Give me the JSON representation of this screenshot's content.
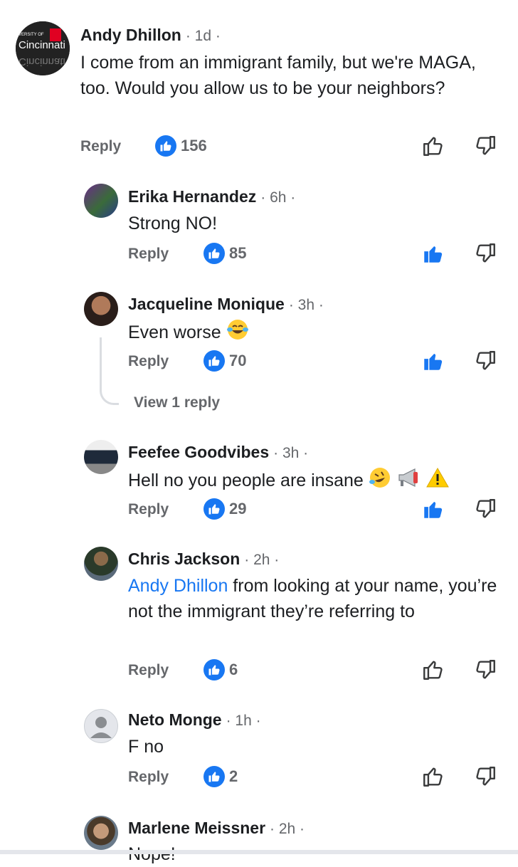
{
  "comments": [
    {
      "name": "Andy Dhillon",
      "meta": "· 1d ·",
      "text": "I come from an immigrant family, but we're MAGA, too. Would you allow us to be your neighbors?",
      "reply": "Reply",
      "likes": "156",
      "logo_text": "Cincinnati",
      "logo_small": "VERSITY OF"
    },
    {
      "name": "Erika Hernandez",
      "meta": "· 6h ·",
      "text": "Strong NO!",
      "reply": "Reply",
      "likes": "85"
    },
    {
      "name": "Jacqueline Monique",
      "meta": "· 3h ·",
      "text": "Even worse",
      "reply": "Reply",
      "likes": "70",
      "view_replies": "View 1 reply"
    },
    {
      "name": "Feefee Goodvibes",
      "meta": "· 3h ·",
      "text": "Hell no you people are insane",
      "reply": "Reply",
      "likes": "29"
    },
    {
      "name": "Chris Jackson",
      "meta": "· 2h ·",
      "mention": "Andy Dhillon",
      "text": " from looking at your name, you’re not the immigrant they’re referring to",
      "reply": "Reply",
      "likes": "6"
    },
    {
      "name": "Neto Monge",
      "meta": "· 1h ·",
      "text": "F no",
      "reply": "Reply",
      "likes": "2"
    },
    {
      "name": "Marlene Meissner",
      "meta": "· 2h ·",
      "text": "Nope!"
    }
  ],
  "colors": {
    "accent": "#1877f2",
    "muted": "#65676b"
  }
}
